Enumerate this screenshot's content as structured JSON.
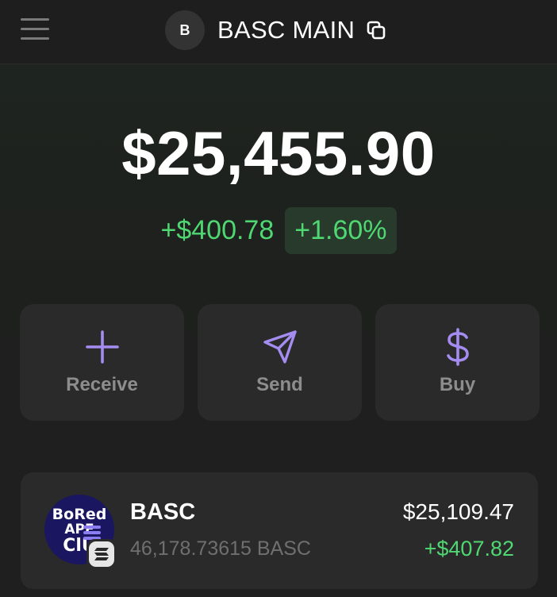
{
  "header": {
    "avatar_letter": "B",
    "account_name": "BASC MAIN"
  },
  "balance": {
    "total": "$25,455.90",
    "change_abs": "+$400.78",
    "change_pct": "+1.60%"
  },
  "actions": [
    {
      "label": "Receive",
      "icon": "plus-icon"
    },
    {
      "label": "Send",
      "icon": "paper-plane-icon"
    },
    {
      "label": "Buy",
      "icon": "dollar-icon"
    }
  ],
  "tokens": [
    {
      "name": "BASC",
      "amount": "46,178.73615 BASC",
      "value": "$25,109.47",
      "change": "+$407.82",
      "logo_text": [
        "BoRed",
        "APE",
        "ClU"
      ]
    }
  ],
  "colors": {
    "accent": "#a48cf0",
    "positive": "#4fd872",
    "card": "#2a2a2a"
  }
}
